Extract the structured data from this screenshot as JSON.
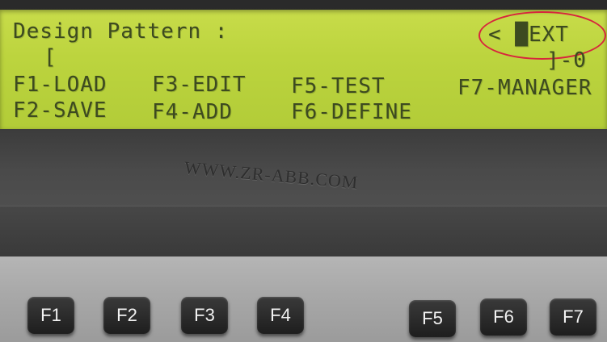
{
  "lcd": {
    "title": "Design Pattern :",
    "mode": "< █EXT",
    "bracket_open": "[",
    "bracket_close": "]-0",
    "row1": [
      "F1-LOAD",
      "F3-EDIT",
      "F5-TEST",
      "F7-MANAGER"
    ],
    "row2": [
      "F2-SAVE",
      "F4-ADD",
      "F6-DEFINE"
    ]
  },
  "watermark": "WWW.ZR-ABB.COM",
  "keys": [
    "F1",
    "F2",
    "F3",
    "F4",
    "F5",
    "F6",
    "F7"
  ],
  "colors": {
    "lcd_background": "#bcd43e",
    "lcd_text": "#3d4a20",
    "highlight_circle": "#d7263d",
    "key_face": "#2a2a2a"
  }
}
